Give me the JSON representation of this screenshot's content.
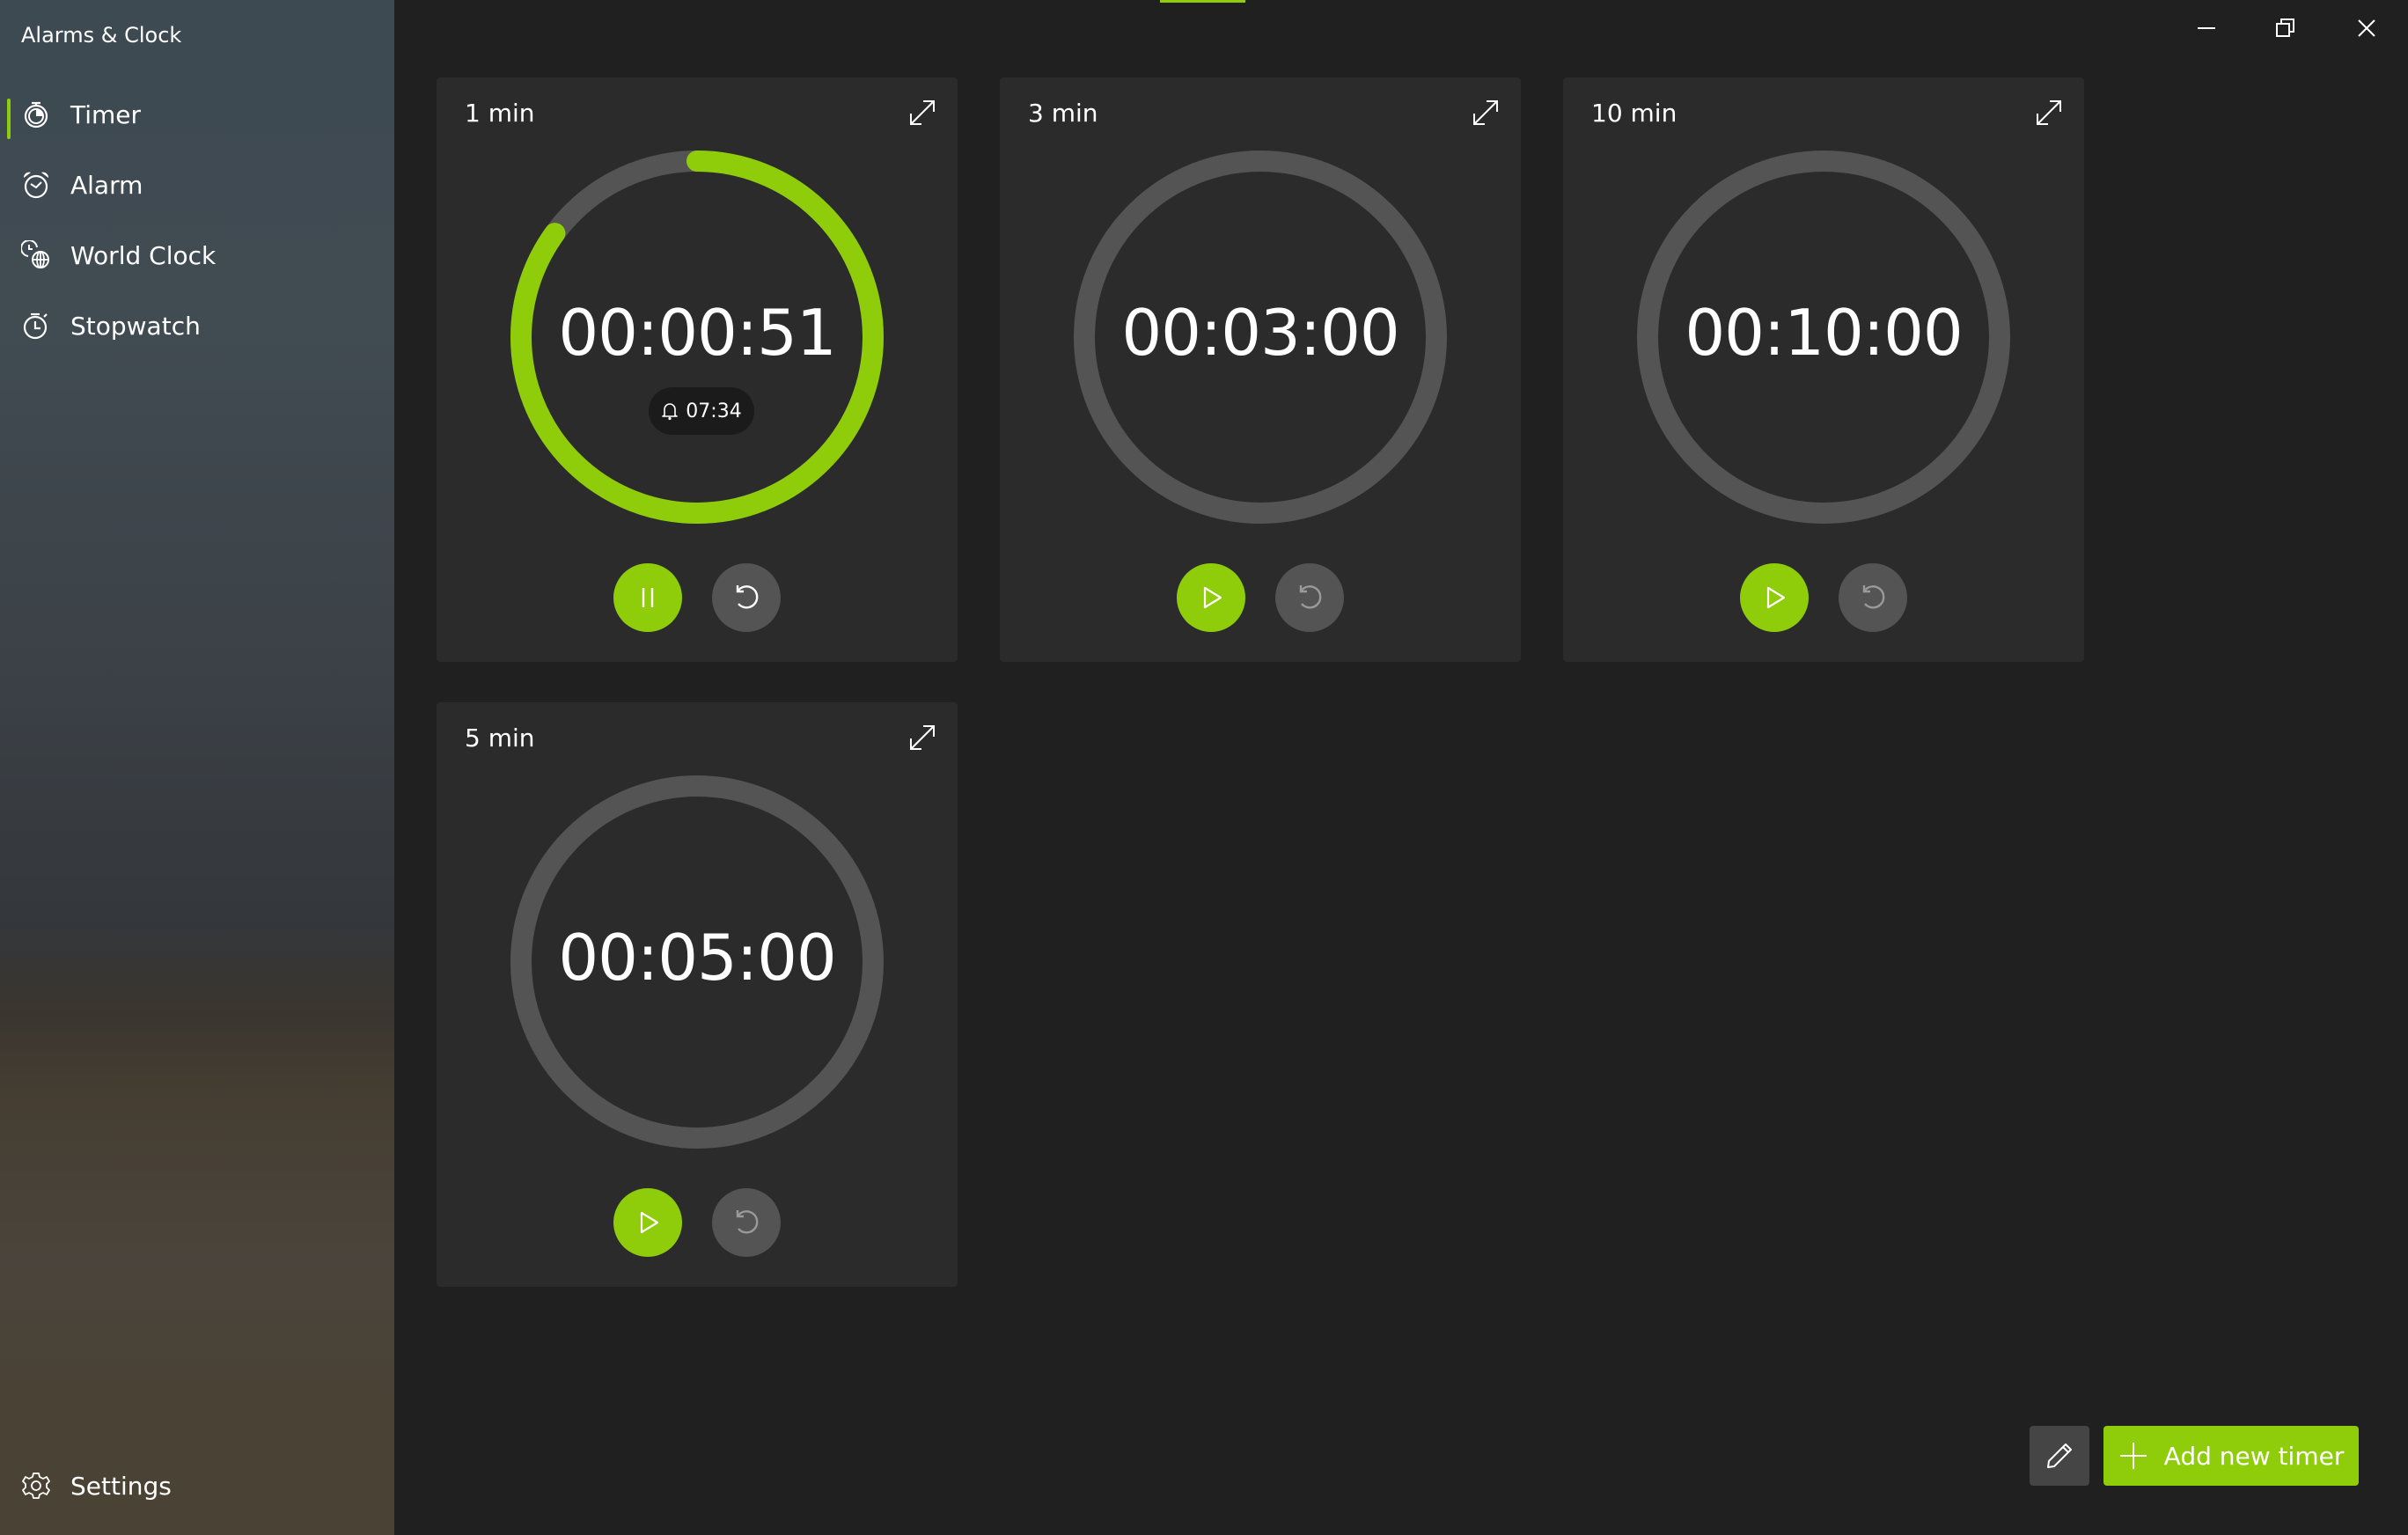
{
  "app": {
    "title": "Alarms & Clock"
  },
  "colors": {
    "accent": "#8fcd0a",
    "track": "#545454",
    "card": "#2b2b2b",
    "background": "#202020"
  },
  "nav": {
    "items": [
      {
        "label": "Timer",
        "icon": "timer-icon",
        "selected": true
      },
      {
        "label": "Alarm",
        "icon": "alarm-clock-icon",
        "selected": false
      },
      {
        "label": "World Clock",
        "icon": "world-clock-icon",
        "selected": false
      },
      {
        "label": "Stopwatch",
        "icon": "stopwatch-icon",
        "selected": false
      }
    ],
    "settings": {
      "label": "Settings",
      "icon": "gear-icon"
    }
  },
  "window_controls": {
    "minimize": "minimize-icon",
    "restore": "restore-icon",
    "close": "close-icon"
  },
  "timers": [
    {
      "name": "1 min",
      "time": "00:00:51",
      "running": true,
      "progress": 0.85,
      "end_time": "07:34",
      "primary_action": "pause",
      "reset_enabled": true
    },
    {
      "name": "3 min",
      "time": "00:03:00",
      "running": false,
      "progress": 0,
      "end_time": null,
      "primary_action": "play",
      "reset_enabled": false
    },
    {
      "name": "10 min",
      "time": "00:10:00",
      "running": false,
      "progress": 0,
      "end_time": null,
      "primary_action": "play",
      "reset_enabled": false
    },
    {
      "name": "5 min",
      "time": "00:05:00",
      "running": false,
      "progress": 0,
      "end_time": null,
      "primary_action": "play",
      "reset_enabled": false
    }
  ],
  "footer": {
    "edit_icon": "pencil-icon",
    "add_label": "Add new timer",
    "add_icon": "plus-icon"
  }
}
